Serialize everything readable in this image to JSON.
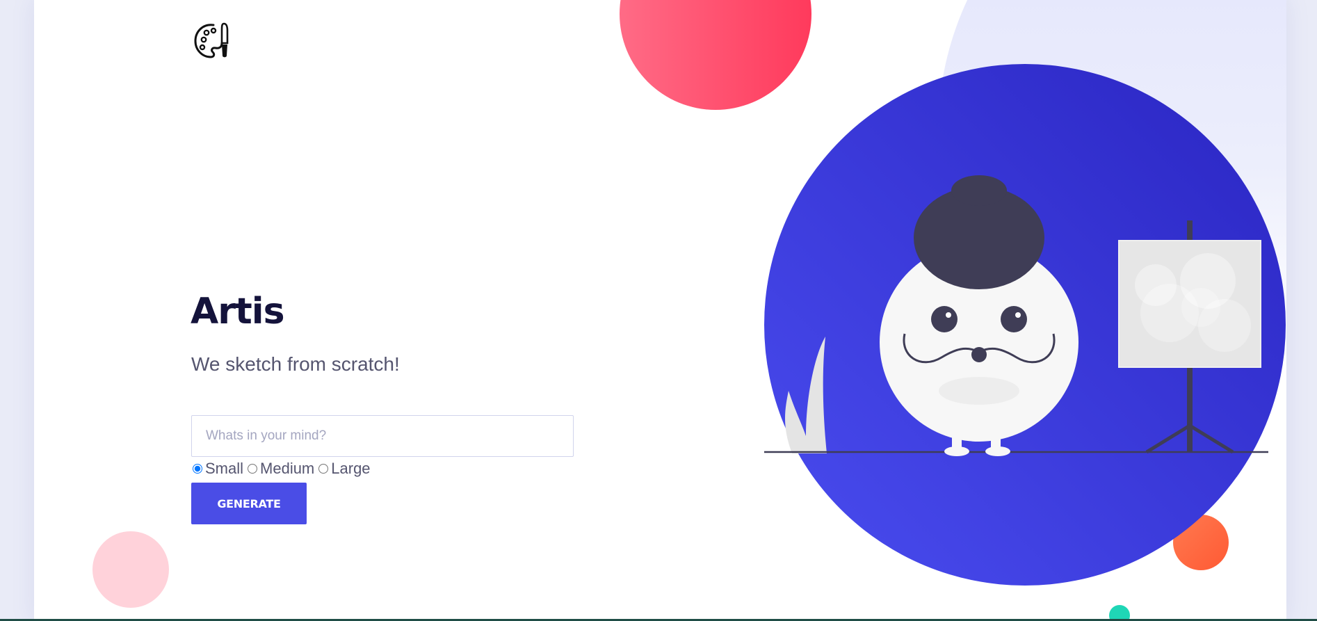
{
  "hero": {
    "title": "Artis",
    "subtitle": "We sketch from scratch!"
  },
  "prompt": {
    "placeholder": "Whats in your mind?",
    "value": ""
  },
  "size_options": {
    "small": "Small",
    "medium": "Medium",
    "large": "Large",
    "selected": "Small"
  },
  "generate_button": {
    "label": "GENERATE"
  },
  "icons": {
    "logo": "palette-brush-icon"
  },
  "colors": {
    "accent": "#4a4de6",
    "title": "#14133b",
    "text": "#55556f",
    "illustration_circle": "#3a3ad8",
    "red_circle": "#ff4d6d",
    "orange_circle": "#ff6a42",
    "pink_circle": "#ffd2da",
    "teal_circle": "#1fd6b6"
  }
}
